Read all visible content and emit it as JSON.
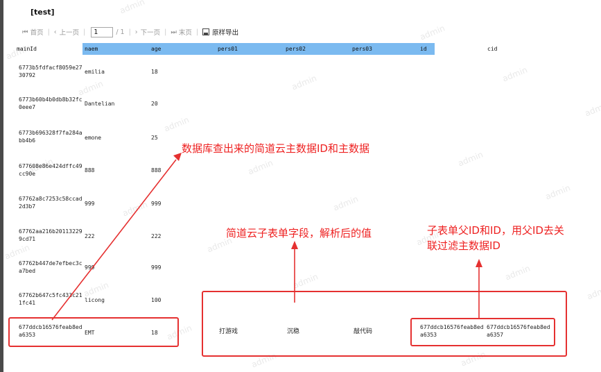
{
  "report": {
    "title": "[test]",
    "toolbar": {
      "first": "首页",
      "prev": "上一页",
      "page_value": "1",
      "page_total": "/ 1",
      "next": "下一页",
      "last": "末页",
      "export": "原样导出",
      "first_icon": "⏮",
      "prev_icon": "‹",
      "next_icon": "›",
      "last_icon": "⏭"
    },
    "columns": [
      "mainId",
      "naem",
      "age",
      "pers01",
      "pers02",
      "pers03",
      "id",
      "cid"
    ],
    "header_highlight_color": "#7bbaf0",
    "rows": [
      {
        "mainId": "6773b5fdfacf8059e27\n30792",
        "naem": "emilia",
        "age": "18"
      },
      {
        "mainId": "6773b60b4b0db8b32fc\n0eee7",
        "naem": "Dantelian",
        "age": "20"
      },
      {
        "mainId": "6773b696328f7fa284a\nbb4b6",
        "naem": "emone",
        "age": "25"
      },
      {
        "mainId": "677608e86e424dffc49\ncc90e",
        "naem": "888",
        "age": "888"
      },
      {
        "mainId": "67762a8c7253c58ccad\n2d3b7",
        "naem": "999",
        "age": "999"
      },
      {
        "mainId": "67762aa216b20113229\n9cd71",
        "naem": "222",
        "age": "222"
      },
      {
        "mainId": "67762b447de7efbec3c\na7bed",
        "naem": "999",
        "age": "999"
      },
      {
        "mainId": "67762b647c5fc433c21\n1fc41",
        "naem": "licong",
        "age": "100"
      },
      {
        "mainId": "677ddcb16576feab8ed\na6353",
        "naem": "EMT",
        "age": "18",
        "pers01": "打游戏",
        "pers02": "沉稳",
        "pers03": "敲代码",
        "id": "677ddcb16576feab8ed\na6353",
        "cid": "677ddcb16576feab8ed\na6357"
      }
    ]
  },
  "annotations": {
    "main_data": "数据库查出来的简道云主数据ID和主数据",
    "sub_fields": "简道云子表单字段，解析后的值",
    "parent_id_line1": "子表单父ID和ID，用父ID去关",
    "parent_id_line2": "联过滤主数据ID",
    "color": "#ee2222"
  },
  "watermark": "admin"
}
